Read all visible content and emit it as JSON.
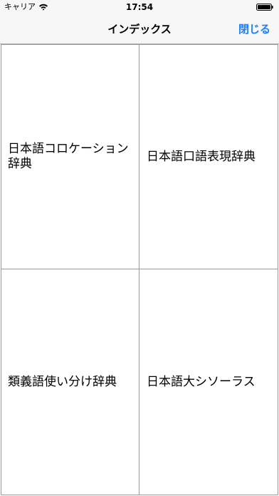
{
  "status_bar": {
    "carrier": "キャリア",
    "time": "17:54",
    "wifi_icon": "wifi-icon",
    "battery_icon": "battery-icon"
  },
  "nav": {
    "title": "インデックス",
    "close_label": "閉じる",
    "accent_color": "#1e7ff7"
  },
  "dictionaries": [
    {
      "label": "日本語コロケーション辞典"
    },
    {
      "label": "日本語口語表現辞典"
    },
    {
      "label": "類義語使い分け辞典"
    },
    {
      "label": "日本語大シソーラス"
    }
  ]
}
